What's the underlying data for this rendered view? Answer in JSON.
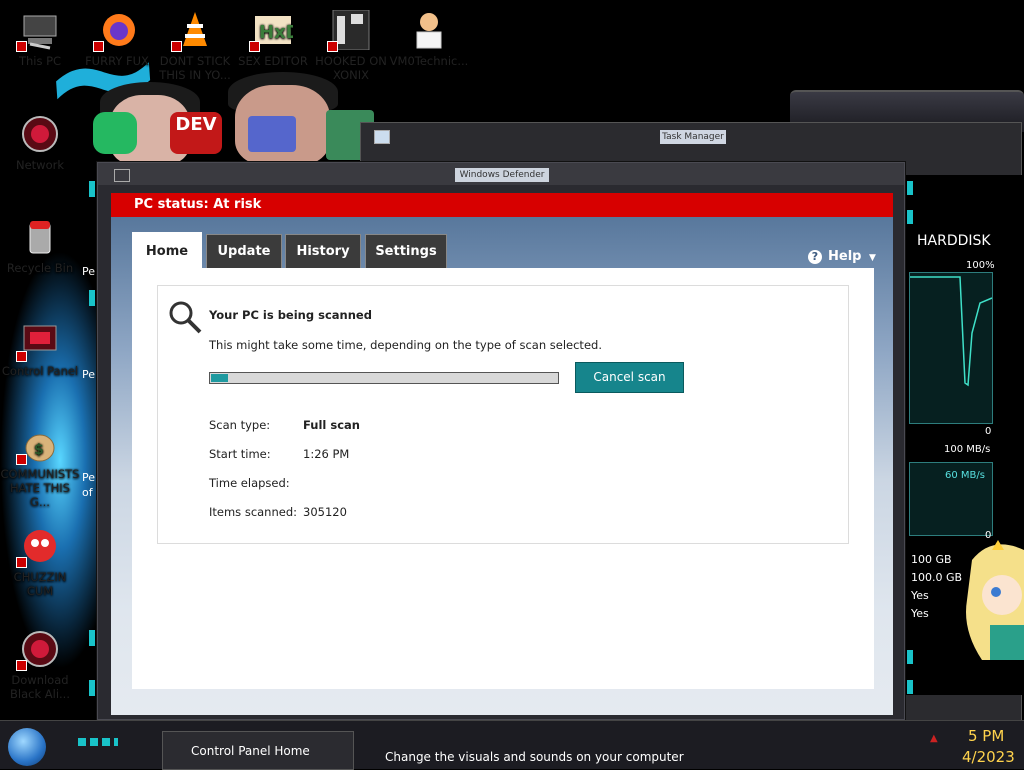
{
  "desktop": {
    "icons": [
      {
        "label": "This PC",
        "icon": "this-pc-icon"
      },
      {
        "label": "FURRY FUX",
        "icon": "firefox-icon"
      },
      {
        "label": "DONT STICK THIS IN YO...",
        "icon": "vlc-cone-icon"
      },
      {
        "label": "SEX EDITOR",
        "icon": "hxd-editor-icon"
      },
      {
        "label": "HOOKED ON XONIX",
        "icon": "xonix-game-icon"
      },
      {
        "label": "VM0Technic...",
        "icon": "doctor-avatar-icon"
      },
      {
        "label": "Network",
        "icon": "network-icon"
      },
      {
        "label": "Recycle Bin",
        "icon": "recycle-bin-icon"
      },
      {
        "label": "Control Panel",
        "icon": "control-panel-icon"
      },
      {
        "label": "COMMUNISTS HATE THIS G...",
        "icon": "money-bag-icon"
      },
      {
        "label": "CHUZZIN CUM",
        "icon": "chuzzle-icon"
      },
      {
        "label": "Download Black Ali...",
        "icon": "download-icon"
      }
    ],
    "partial_labels": [
      "Pe",
      "Pe",
      "Pe",
      "of"
    ]
  },
  "task_manager": {
    "title": "Task Manager",
    "panel_heading": "HARDDISK",
    "percent_label": "100%",
    "zero_label_1": "0",
    "speed_max": "100 MB/s",
    "speed_current": "60 MB/s",
    "zero_label_2": "0",
    "stats": [
      "100 GB",
      "100.0 GB",
      "Yes",
      "Yes"
    ]
  },
  "defender": {
    "window_title": "Windows Defender",
    "status": "PC status: At risk",
    "tabs": [
      "Home",
      "Update",
      "History",
      "Settings"
    ],
    "active_tab": "Home",
    "help_label": "Help",
    "scan": {
      "heading": "Your PC is being scanned",
      "description": "This might take some time, depending on the type of scan selected.",
      "progress": 0.05,
      "cancel_label": "Cancel scan",
      "details": [
        {
          "label": "Scan type:",
          "value": "Full scan",
          "bold": true
        },
        {
          "label": "Start time:",
          "value": "1:26 PM",
          "bold": false
        },
        {
          "label": "Time elapsed:",
          "value": "",
          "bold": false
        },
        {
          "label": "Items scanned:",
          "value": "305120",
          "bold": false
        }
      ]
    },
    "colors": {
      "status_red": "#d70000",
      "accent_teal": "#16858c"
    }
  },
  "control_panel": {
    "home_link": "Control Panel Home",
    "description": "Change the visuals and sounds on your computer"
  },
  "clock": {
    "time_partial": "5 PM",
    "date_partial": "4/2023"
  }
}
